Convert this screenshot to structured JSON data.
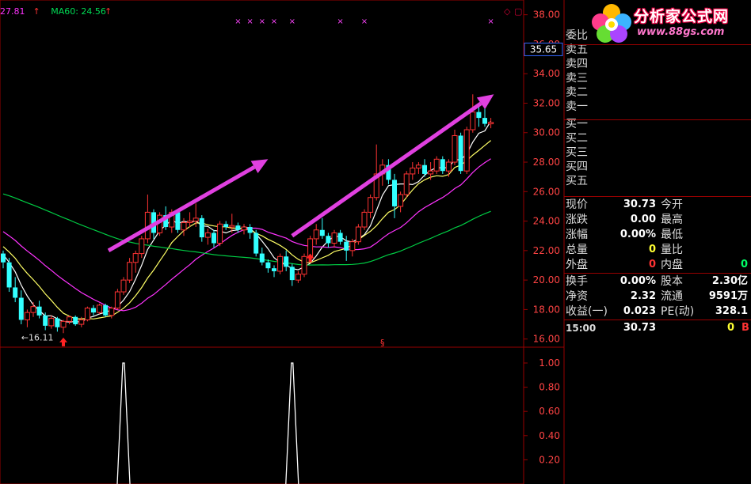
{
  "header": {
    "ma_label_1": "27.81",
    "ma_label_2": "MA60: 24.56",
    "ma_label_2_color": "#00dd55",
    "ma_label_1_color": "#ff33ff"
  },
  "logo": {
    "title": "分析家公式网",
    "url": "www.88gs.com"
  },
  "colors": {
    "up": "#ff3333",
    "down": "#33ffff",
    "grid": "#990000",
    "ma5": "#ffffff",
    "ma10": "#ffff66",
    "ma20": "#ff33ff",
    "ma60": "#00cc44",
    "arrow": "#e040e0",
    "signal": "#ffffff"
  },
  "chart_data": [
    {
      "type": "candlestick",
      "y_ticks": [
        "38.00",
        "36.00",
        "34.00",
        "32.00",
        "30.00",
        "28.00",
        "26.00",
        "24.00",
        "22.00",
        "20.00",
        "18.00",
        "16.00"
      ],
      "ylim": [
        15.5,
        39.0
      ],
      "current_price_label": "35.65",
      "low_label": "←16.11",
      "candles": [
        [
          21.8,
          22.0,
          20.8,
          21.2
        ],
        [
          21.2,
          21.5,
          19.2,
          19.5
        ],
        [
          19.5,
          20.2,
          18.5,
          18.8
        ],
        [
          18.8,
          19.3,
          17.0,
          17.3
        ],
        [
          17.3,
          18.0,
          16.8,
          17.8
        ],
        [
          17.8,
          18.5,
          17.5,
          18.2
        ],
        [
          18.2,
          18.6,
          17.4,
          17.6
        ],
        [
          17.6,
          17.8,
          16.6,
          16.9
        ],
        [
          16.9,
          17.6,
          16.7,
          17.4
        ],
        [
          17.4,
          17.5,
          16.5,
          16.8
        ],
        [
          16.8,
          17.3,
          16.4,
          17.2
        ],
        [
          17.2,
          17.6,
          17.0,
          17.5
        ],
        [
          17.5,
          17.6,
          16.9,
          17.0
        ],
        [
          17.0,
          17.5,
          16.8,
          17.3
        ],
        [
          17.3,
          18.2,
          17.2,
          18.1
        ],
        [
          18.1,
          18.3,
          17.6,
          17.8
        ],
        [
          17.8,
          18.4,
          17.7,
          18.3
        ],
        [
          18.3,
          18.4,
          17.5,
          17.6
        ],
        [
          17.6,
          18.2,
          17.4,
          18.1
        ],
        [
          18.1,
          19.4,
          18.0,
          19.2
        ],
        [
          19.2,
          20.2,
          19.0,
          20.0
        ],
        [
          20.0,
          21.5,
          19.8,
          21.2
        ],
        [
          21.2,
          22.0,
          20.5,
          21.8
        ],
        [
          21.8,
          23.0,
          21.5,
          22.8
        ],
        [
          22.8,
          25.8,
          22.5,
          24.6
        ],
        [
          24.6,
          24.8,
          22.8,
          23.2
        ],
        [
          23.2,
          24.6,
          23.0,
          24.4
        ],
        [
          24.4,
          25.0,
          23.4,
          23.6
        ],
        [
          23.6,
          24.8,
          23.2,
          24.6
        ],
        [
          24.6,
          24.8,
          23.2,
          23.4
        ],
        [
          23.4,
          24.2,
          23.0,
          23.9
        ],
        [
          23.9,
          24.6,
          23.6,
          24.0
        ],
        [
          24.0,
          25.2,
          23.6,
          24.2
        ],
        [
          24.2,
          24.4,
          22.6,
          22.9
        ],
        [
          22.9,
          23.5,
          22.4,
          23.2
        ],
        [
          23.2,
          23.4,
          22.2,
          22.5
        ],
        [
          22.5,
          24.0,
          22.3,
          23.8
        ],
        [
          23.8,
          24.0,
          23.4,
          23.6
        ],
        [
          23.6,
          24.5,
          23.2,
          23.7
        ],
        [
          23.7,
          23.9,
          23.2,
          23.4
        ],
        [
          23.4,
          23.8,
          23.1,
          23.6
        ],
        [
          23.6,
          23.8,
          22.8,
          23.2
        ],
        [
          23.2,
          23.4,
          21.6,
          21.8
        ],
        [
          21.8,
          22.2,
          21.0,
          21.2
        ],
        [
          21.2,
          21.4,
          20.5,
          20.8
        ],
        [
          20.8,
          21.0,
          20.2,
          20.6
        ],
        [
          20.6,
          21.8,
          20.4,
          21.6
        ],
        [
          21.6,
          22.0,
          20.6,
          20.9
        ],
        [
          20.9,
          21.1,
          19.6,
          20.0
        ],
        [
          20.0,
          20.6,
          19.8,
          20.4
        ],
        [
          20.4,
          21.8,
          20.2,
          21.6
        ],
        [
          21.6,
          23.0,
          21.4,
          22.8
        ],
        [
          22.8,
          23.8,
          22.4,
          23.4
        ],
        [
          23.4,
          24.2,
          22.8,
          23.0
        ],
        [
          23.0,
          23.2,
          22.2,
          22.5
        ],
        [
          22.5,
          23.4,
          22.2,
          23.2
        ],
        [
          23.2,
          23.4,
          22.4,
          22.6
        ],
        [
          22.6,
          23.0,
          21.3,
          22.0
        ],
        [
          22.0,
          22.8,
          21.6,
          22.6
        ],
        [
          22.6,
          23.8,
          22.4,
          23.6
        ],
        [
          23.6,
          24.8,
          23.4,
          24.6
        ],
        [
          24.6,
          25.8,
          24.2,
          25.6
        ],
        [
          25.6,
          29.2,
          25.4,
          27.2
        ],
        [
          27.2,
          28.2,
          26.4,
          27.8
        ],
        [
          27.8,
          28.2,
          26.5,
          26.8
        ],
        [
          26.8,
          27.2,
          24.2,
          25.0
        ],
        [
          25.0,
          26.0,
          24.6,
          25.8
        ],
        [
          25.8,
          27.4,
          25.6,
          27.2
        ],
        [
          27.2,
          28.0,
          26.8,
          27.6
        ],
        [
          27.6,
          28.0,
          27.2,
          27.8
        ],
        [
          27.8,
          28.2,
          27.0,
          27.2
        ],
        [
          27.2,
          28.0,
          26.8,
          27.4
        ],
        [
          27.4,
          28.4,
          27.2,
          28.2
        ],
        [
          28.2,
          28.4,
          27.2,
          27.4
        ],
        [
          27.4,
          28.2,
          27.0,
          28.0
        ],
        [
          28.0,
          30.2,
          27.8,
          29.8
        ],
        [
          29.8,
          30.0,
          27.2,
          27.4
        ],
        [
          27.4,
          30.4,
          27.2,
          30.2
        ],
        [
          30.2,
          32.6,
          30.0,
          31.4
        ],
        [
          31.4,
          31.8,
          30.4,
          31.0
        ],
        [
          31.0,
          32.2,
          30.4,
          30.6
        ],
        [
          30.6,
          31.0,
          30.3,
          30.7
        ]
      ],
      "ma_periods": [
        5,
        10,
        20,
        60
      ]
    },
    {
      "type": "line",
      "y_ticks": [
        "1.00",
        "0.80",
        "0.60",
        "0.40",
        "0.20"
      ],
      "ylim": [
        0,
        1.0
      ],
      "signal_indices": [
        20,
        48
      ]
    }
  ],
  "panel": {
    "order_labels": [
      "委比",
      "卖五",
      "卖四",
      "卖三",
      "卖二",
      "卖一",
      "买一",
      "买二",
      "买三",
      "买四",
      "买五"
    ],
    "quote_rows": [
      {
        "l1": "现价",
        "v1": "30.73",
        "c1": "#ffffff",
        "l2": "今开",
        "v2": "",
        "c2": "#ffffff"
      },
      {
        "l1": "涨跌",
        "v1": "0.00",
        "c1": "#ffffff",
        "l2": "最高",
        "v2": "",
        "c2": "#ffffff"
      },
      {
        "l1": "涨幅",
        "v1": "0.00%",
        "c1": "#ffffff",
        "l2": "最低",
        "v2": "",
        "c2": "#ffffff"
      },
      {
        "l1": "总量",
        "v1": "0",
        "c1": "#ffff33",
        "l2": "量比",
        "v2": "",
        "c2": "#ffffff"
      },
      {
        "l1": "外盘",
        "v1": "0",
        "c1": "#ff3333",
        "l2": "内盘",
        "v2": "0",
        "c2": "#00ff66"
      }
    ],
    "finance_rows": [
      {
        "l1": "换手",
        "v1": "0.00%",
        "l2": "股本",
        "v2": "2.30亿"
      },
      {
        "l1": "净资",
        "v1": "2.32",
        "l2": "流通",
        "v2": "9591万"
      },
      {
        "l1": "收益(一)",
        "v1": "0.023",
        "l2": "PE(动)",
        "v2": "328.1"
      }
    ],
    "tick": {
      "time": "15:00",
      "price": "30.73",
      "vol": "0",
      "side": "B"
    }
  }
}
